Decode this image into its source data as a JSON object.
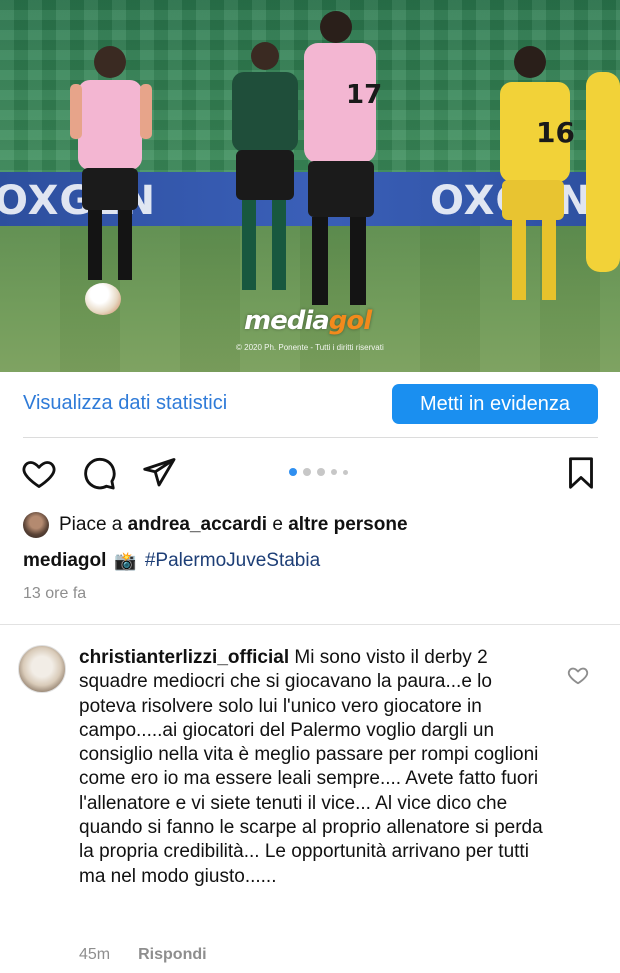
{
  "photo": {
    "banner_left": "OXGEN",
    "banner_right": "OXGEN",
    "watermark_brand_a": "media",
    "watermark_brand_b": "gol",
    "watermark_copyright": "© 2020 Ph. Ponente - Tutti i diritti riservati",
    "player_numbers": [
      "17",
      "16"
    ]
  },
  "actions": {
    "stats_link": "Visualizza dati statistici",
    "boost_button": "Metti in evidenza",
    "carousel": {
      "count": 5,
      "active_index": 0
    },
    "icons": [
      "heart-icon",
      "comment-icon",
      "share-icon",
      "bookmark-icon"
    ]
  },
  "likes": {
    "prefix": "Piace a ",
    "user": "andrea_accardi",
    "middle": " e ",
    "others": "altre persone"
  },
  "caption": {
    "user": "mediagol",
    "emoji": "📸",
    "hashtag": "#PalermoJuveStabia",
    "time": "13 ore fa"
  },
  "comment": {
    "user": "christianterlizzi_official",
    "text": "Mi sono visto il derby 2 squadre mediocri che si giocavano la paura...e lo poteva risolvere solo lui l'unico vero giocatore in campo.....ai giocatori del Palermo voglio dargli un consiglio nella vita è meglio passare per rompi coglioni come ero io ma essere leali sempre.... Avete fatto fuori l'allenatore e vi siete tenuti il vice... Al vice dico che quando si fanno le scarpe al proprio allenatore si perda la propria credibilità... Le opportunità arrivano per tutti ma nel modo giusto......",
    "time": "45m",
    "reply": "Rispondi"
  },
  "colors": {
    "link_blue": "#2f7bd8",
    "button_blue": "#1a8ff0",
    "hashtag_blue": "#1d3e76",
    "muted_gray": "#8e8e8e"
  }
}
